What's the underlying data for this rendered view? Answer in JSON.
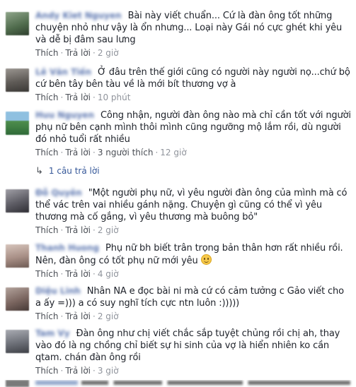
{
  "labels": {
    "like": "Thích",
    "reply": "Trả lời",
    "dot": "·"
  },
  "comments": [
    {
      "name": "Andy Kiet Nguyen",
      "text": "Bài này viết chuẩn... Cứ là đàn ông tốt những chuyện nhỏ như vậy là ổn nhưng... Loại này Gái nó cực ghét khi yêu và dễ bị đâm sau lưng",
      "time": "2 giờ",
      "likes": "",
      "avatar_color": "#5b7a5a"
    },
    {
      "name": "Lê Văn Tiến",
      "text": "Ở đâu trên thế giới cũng có người này người nọ...chứ bộ cứ bên tây bên tàu về là mới bít thương vợ à",
      "time": "10 phút",
      "likes": "",
      "avatar_color": "#6e6a66"
    },
    {
      "name": "Huu Nguyen",
      "text": "Công nhận, người đàn ông nào mà chỉ cần tốt với người phụ nữ bên cạnh mình thôi mình cũng ngưỡng mộ lắm rồi, dù người đó nhỏ tuổi rất nhiều",
      "time": "12 giờ",
      "likes": "3 người thích",
      "avatar_color": "#3f7a4e"
    },
    {
      "name": "Đỗ Quyên",
      "text": "\"Một người phụ nữ, vì yêu người đàn ông của mình mà có thể vác trên vai nhiều gánh nặng. Chuyện gì cũng có thể vì yêu thương mà cố gắng, vì yêu thương mà buông bỏ\"",
      "time": "2 giờ",
      "likes": "",
      "avatar_color": "#6a6a72"
    },
    {
      "name": "Thanh Huong",
      "text": "Phụ nữ bh biết trân trọng bản thân hơn rất nhiều rồi. Nên, đàn ông có tốt phụ nữ mới yêu",
      "time": "4 giờ",
      "likes": "",
      "avatar_color": "#b59a90"
    },
    {
      "name": "Diệu Linh",
      "mention": "Nhân NA",
      "text": "e đọc bài ni mà cứ có cảm tưởng c Gảo viết cho a ấy =))) a có suy nghĩ tích cực ntn luôn :)))))",
      "time": "2 giờ",
      "likes": "",
      "avatar_color": "#8a7772"
    },
    {
      "name": "Tam Vy",
      "text": "Đàn ông như chị viết chắc sắp tuyệt chủng rồi chị ah, thay vào đó là ng chồng chỉ biết sự hi sinh của vợ là hiển nhiên ko cần qtam. chán đàn ông rồi",
      "time": "3 giờ",
      "likes": "",
      "avatar_color": "#7d7f86"
    }
  ],
  "replies_link": "1 câu trả lời",
  "icons": {
    "reply_arrow": "reply-arrow-icon",
    "emoji": "smile-emoji-icon"
  }
}
